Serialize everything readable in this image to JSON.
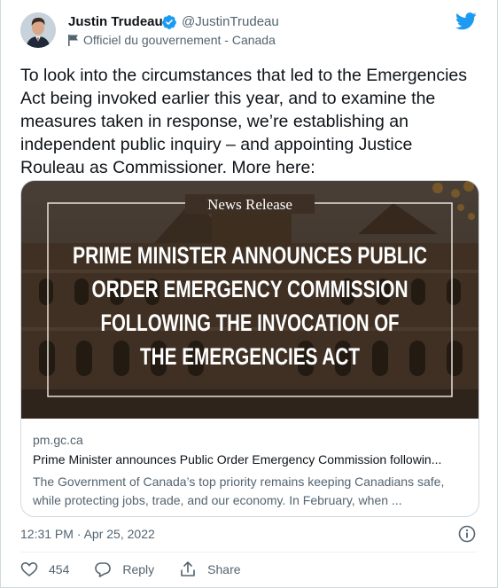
{
  "author": {
    "name": "Justin Trudeau",
    "handle": "@JustinTrudeau",
    "affiliation": "Officiel du gouvernement - Canada"
  },
  "tweet": {
    "text": "To look into the circumstances that led to the Emergencies Act being invoked earlier this year, and to examine the measures taken in response, we’re establishing an independent public inquiry – and appointing Justice Rouleau as Commissioner. More here:",
    "timestamp": "12:31 PM · Apr 25, 2022"
  },
  "card": {
    "image_header": "News Release",
    "image_headline": [
      "PRIME MINISTER ANNOUNCES PUBLIC",
      "ORDER EMERGENCY COMMISSION",
      "FOLLOWING THE INVOCATION OF",
      "THE EMERGENCIES ACT"
    ],
    "domain": "pm.gc.ca",
    "title": "Prime Minister announces Public Order Emergency Commission followin...",
    "description": "The Government of Canada’s top priority remains keeping Canadians safe, while protecting jobs, trade, and our economy. In February, when ..."
  },
  "actions": {
    "like_count": "454",
    "reply_label": "Reply",
    "share_label": "Share"
  },
  "colors": {
    "twitter_blue": "#1d9bf0",
    "secondary_text": "#536471",
    "image_overlay": "#2b2118"
  },
  "icons": [
    "verified-badge-icon",
    "flag-icon",
    "twitter-bird-icon",
    "info-icon",
    "heart-icon",
    "reply-icon",
    "share-icon"
  ]
}
